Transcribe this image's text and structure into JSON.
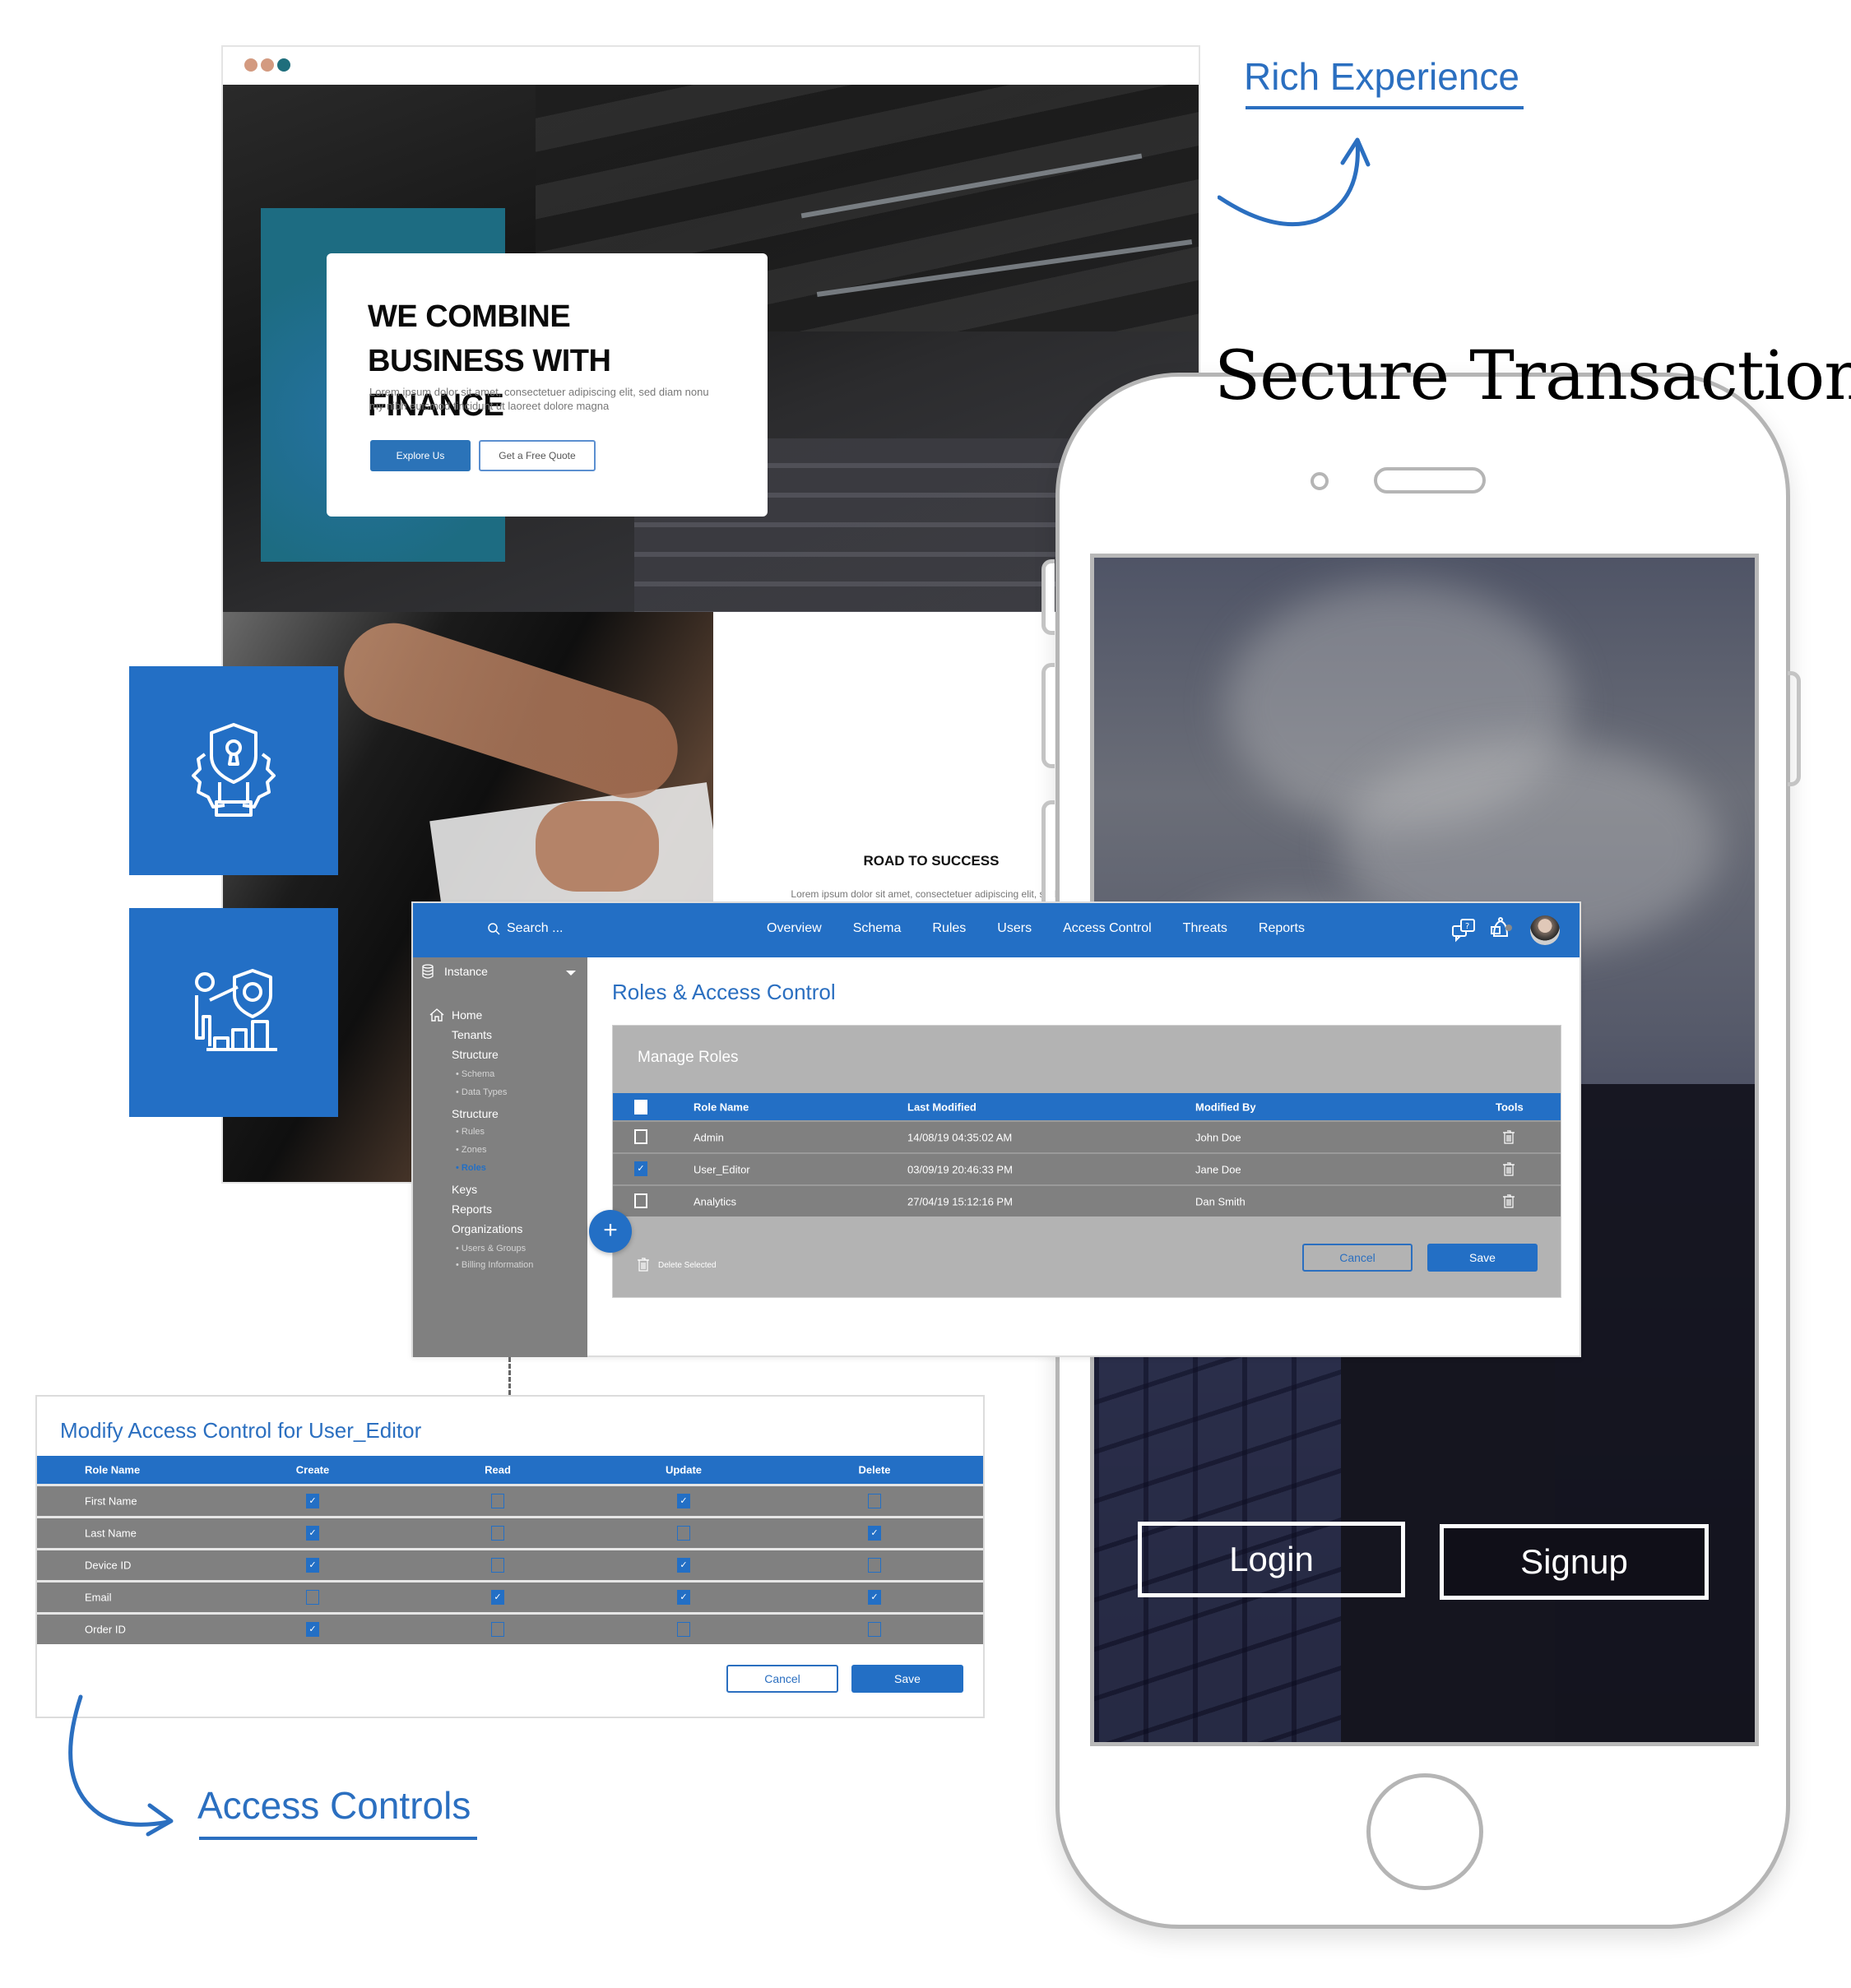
{
  "labels": {
    "rich_experience": "Rich Experience",
    "secure_transactions": "Secure Transactions",
    "access_controls": "Access Controls"
  },
  "colors": {
    "brand_blue": "#236fc5",
    "teal": "#1d6c82",
    "sidebar_gray": "#808080",
    "panel_gray": "#b3b3b3",
    "window_dot_1": "#d39a80",
    "window_dot_2": "#d39a80",
    "window_dot_3": "#1f6e7c"
  },
  "browser": {
    "hero": {
      "heading_line1": "WE COMBINE",
      "heading_line2": "BUSINESS WITH FINANCE",
      "lead": "Lorem ipsum dolor sit amet, consectetuer adipiscing elit, sed diam nonu my nibh euismod tincidunt ut laoreet dolore magna",
      "primary_button": "Explore Us",
      "secondary_button": "Get a Free Quote"
    },
    "road": {
      "title": "ROAD TO SUCCESS",
      "body": "Lorem ipsum dolor sit amet, consectetuer adipiscing elit, sed diam nonu my nibh euismod tincidunt ut laoreet dolore magna aliqua enim minim veniam quis nostrud."
    }
  },
  "tiles": [
    {
      "icon": "shield-keyhole-hand-gear-icon"
    },
    {
      "icon": "person-shield-gear-chart-icon"
    }
  ],
  "phone": {
    "login_button": "Login",
    "signup_button": "Signup"
  },
  "dashboard": {
    "search_placeholder": "Search ...",
    "nav": [
      "Overview",
      "Schema",
      "Rules",
      "Users",
      "Access Control",
      "Threats",
      "Reports"
    ],
    "icons": [
      "help-chat-icon",
      "notification-bell-icon",
      "user-avatar"
    ],
    "sidebar": {
      "instance": "Instance",
      "items": [
        {
          "label": "Home",
          "type": "item",
          "icon": "home-icon"
        },
        {
          "label": "Tenants",
          "type": "item"
        },
        {
          "label": "Structure",
          "type": "item"
        },
        {
          "label": "Schema",
          "type": "sub"
        },
        {
          "label": "Data Types",
          "type": "sub"
        },
        {
          "label": "Structure",
          "type": "item"
        },
        {
          "label": "Rules",
          "type": "sub"
        },
        {
          "label": "Zones",
          "type": "sub"
        },
        {
          "label": "Roles",
          "type": "sub",
          "active": true
        },
        {
          "label": "Keys",
          "type": "item"
        },
        {
          "label": "Reports",
          "type": "item"
        },
        {
          "label": "Organizations",
          "type": "item"
        },
        {
          "label": "Users & Groups",
          "type": "sub"
        },
        {
          "label": "Billing Information",
          "type": "sub"
        }
      ]
    },
    "page_title": "Roles & Access Control",
    "panel_title": "Manage Roles",
    "table": {
      "headers": [
        "Role Name",
        "Last Modified",
        "Modified By",
        "Tools"
      ],
      "rows": [
        {
          "checked": false,
          "role": "Admin",
          "modified": "14/08/19   04:35:02 AM",
          "by": "John Doe"
        },
        {
          "checked": true,
          "role": "User_Editor",
          "modified": "03/09/19   20:46:33 PM",
          "by": "Jane Doe"
        },
        {
          "checked": false,
          "role": "Analytics",
          "modified": "27/04/19   15:12:16 PM",
          "by": "Dan Smith"
        }
      ]
    },
    "delete_selected": "Delete Selected",
    "cancel": "Cancel",
    "save": "Save",
    "add_symbol": "+"
  },
  "access_control": {
    "title": "Modify Access Control for User_Editor",
    "headers": [
      "Role Name",
      "Create",
      "Read",
      "Update",
      "Delete"
    ],
    "rows": [
      {
        "name": "First Name",
        "perms": [
          true,
          false,
          true,
          false
        ]
      },
      {
        "name": "Last Name",
        "perms": [
          true,
          false,
          false,
          true
        ]
      },
      {
        "name": "Device ID",
        "perms": [
          true,
          false,
          true,
          false
        ]
      },
      {
        "name": "Email",
        "perms": [
          false,
          true,
          true,
          true
        ]
      },
      {
        "name": "Order ID",
        "perms": [
          true,
          false,
          false,
          false
        ]
      }
    ],
    "cancel": "Cancel",
    "save": "Save"
  }
}
